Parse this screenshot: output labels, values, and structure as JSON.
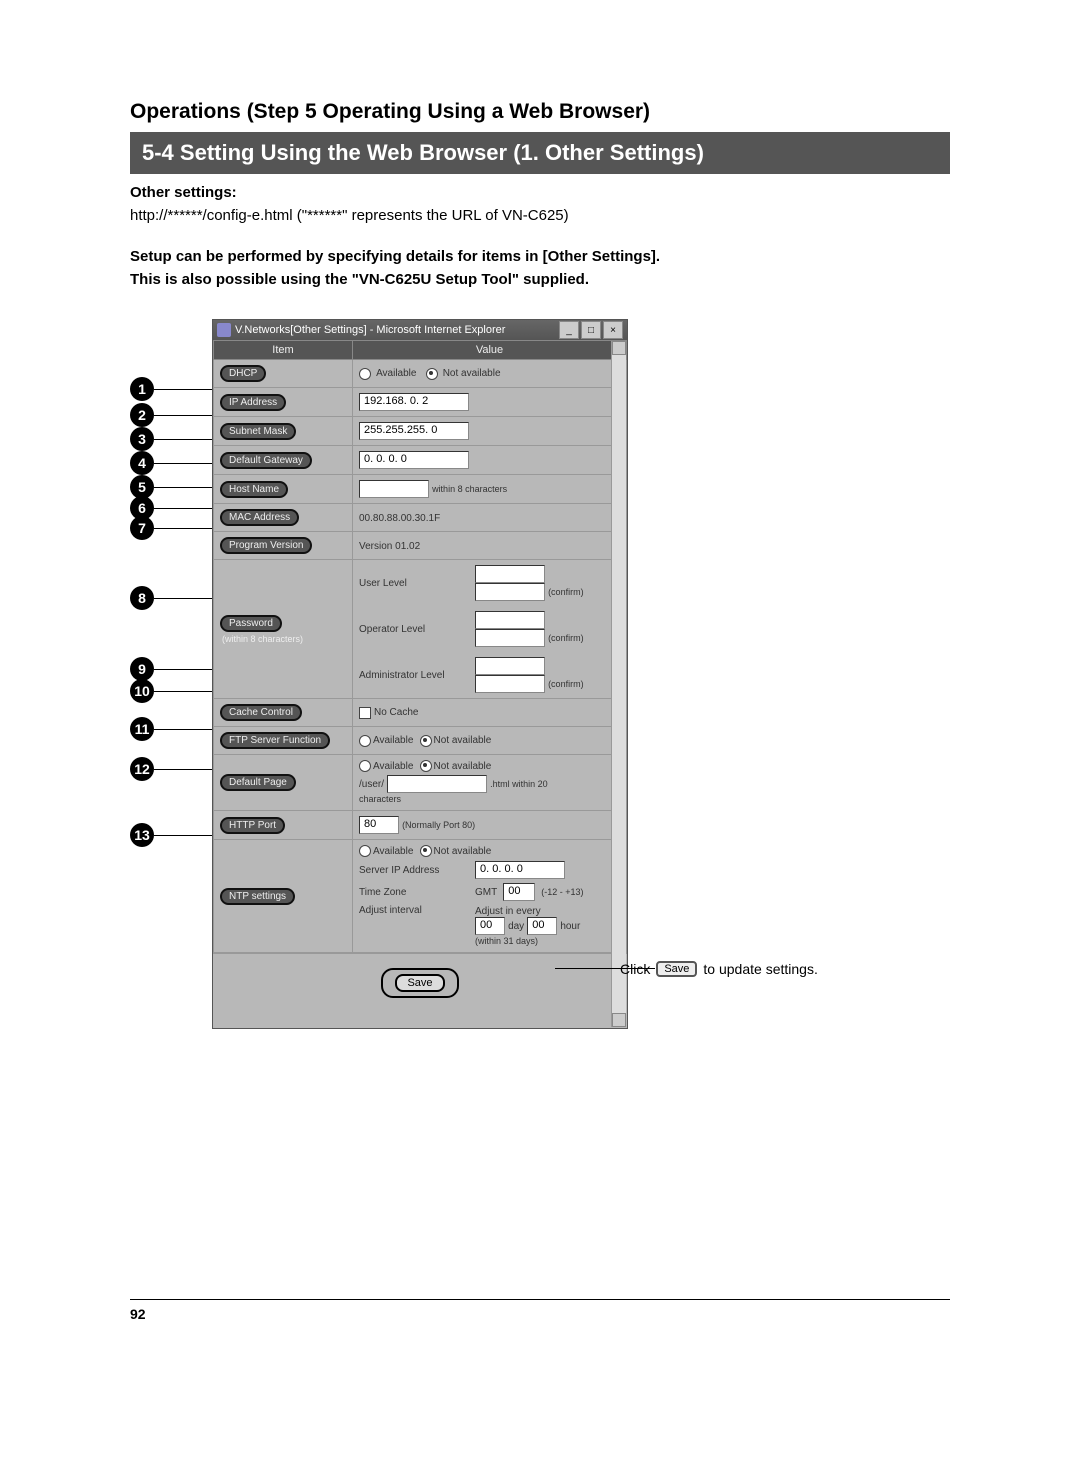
{
  "header": {
    "chapter": "Operations (Step 5 Operating Using a Web Browser)",
    "section_title": "5-4 Setting Using the Web Browser (1. Other Settings)",
    "subhead": "Other settings:",
    "url_line": "http://******/config-e.html (\"******\" represents the URL of VN-C625)",
    "note_line1": "Setup can be performed by specifying details for items in [Other Settings].",
    "note_line2": "This is also possible using the \"VN-C625U Setup Tool\" supplied."
  },
  "window": {
    "title": "V.Networks[Other Settings] - Microsoft Internet Explorer",
    "col_item": "Item",
    "col_value": "Value"
  },
  "labels": {
    "available": "Available",
    "not_available": "Not available",
    "confirm": "(confirm)",
    "no_cache": "No Cache",
    "normally_port": "(Normally Port 80)",
    "html_suffix": ".html within 20",
    "characters": "characters",
    "within8": "within 8 characters",
    "gmt": "GMT",
    "tz_range": "(-12 - +13)",
    "adjust_every": "Adjust in every",
    "day": "day",
    "hour": "hour",
    "within31": "(within 31 days)",
    "save": "Save",
    "user_prefix": "/user/"
  },
  "rows": {
    "dhcp": {
      "badge": "1",
      "label": "DHCP"
    },
    "ip": {
      "badge": "2",
      "label": "IP Address",
      "value": "192.168. 0. 2"
    },
    "subnet": {
      "badge": "3",
      "label": "Subnet Mask",
      "value": "255.255.255. 0"
    },
    "gateway": {
      "badge": "4",
      "label": "Default Gateway",
      "value": " 0. 0. 0. 0"
    },
    "host": {
      "badge": "5",
      "label": "Host Name",
      "value": ""
    },
    "mac": {
      "badge": "6",
      "label": "MAC Address",
      "value": "00.80.88.00.30.1F"
    },
    "ver": {
      "badge": "7",
      "label": "Program Version",
      "value": "Version 01.02"
    },
    "password": {
      "badge": "8",
      "label": "Password",
      "sublabel": "(within 8 characters)",
      "user": "User Level",
      "operator": "Operator Level",
      "admin": "Administrator Level"
    },
    "cache": {
      "badge": "9",
      "label": "Cache Control"
    },
    "ftp": {
      "badge": "10",
      "label": "FTP Server Function"
    },
    "defpage": {
      "badge": "11",
      "label": "Default Page"
    },
    "http": {
      "badge": "12",
      "label": "HTTP Port",
      "value": "80"
    },
    "ntp": {
      "badge": "13",
      "label": "NTP settings",
      "srv_label": "Server IP Address",
      "srv_value": " 0. 0. 0. 0",
      "tz_label": "Time Zone",
      "tz_value": "00",
      "int_label": "Adjust interval",
      "int_day": "00",
      "int_hour": "00"
    }
  },
  "save_callout": {
    "prefix": "Click",
    "button": "Save",
    "suffix": " to update settings."
  },
  "page_number": "92"
}
